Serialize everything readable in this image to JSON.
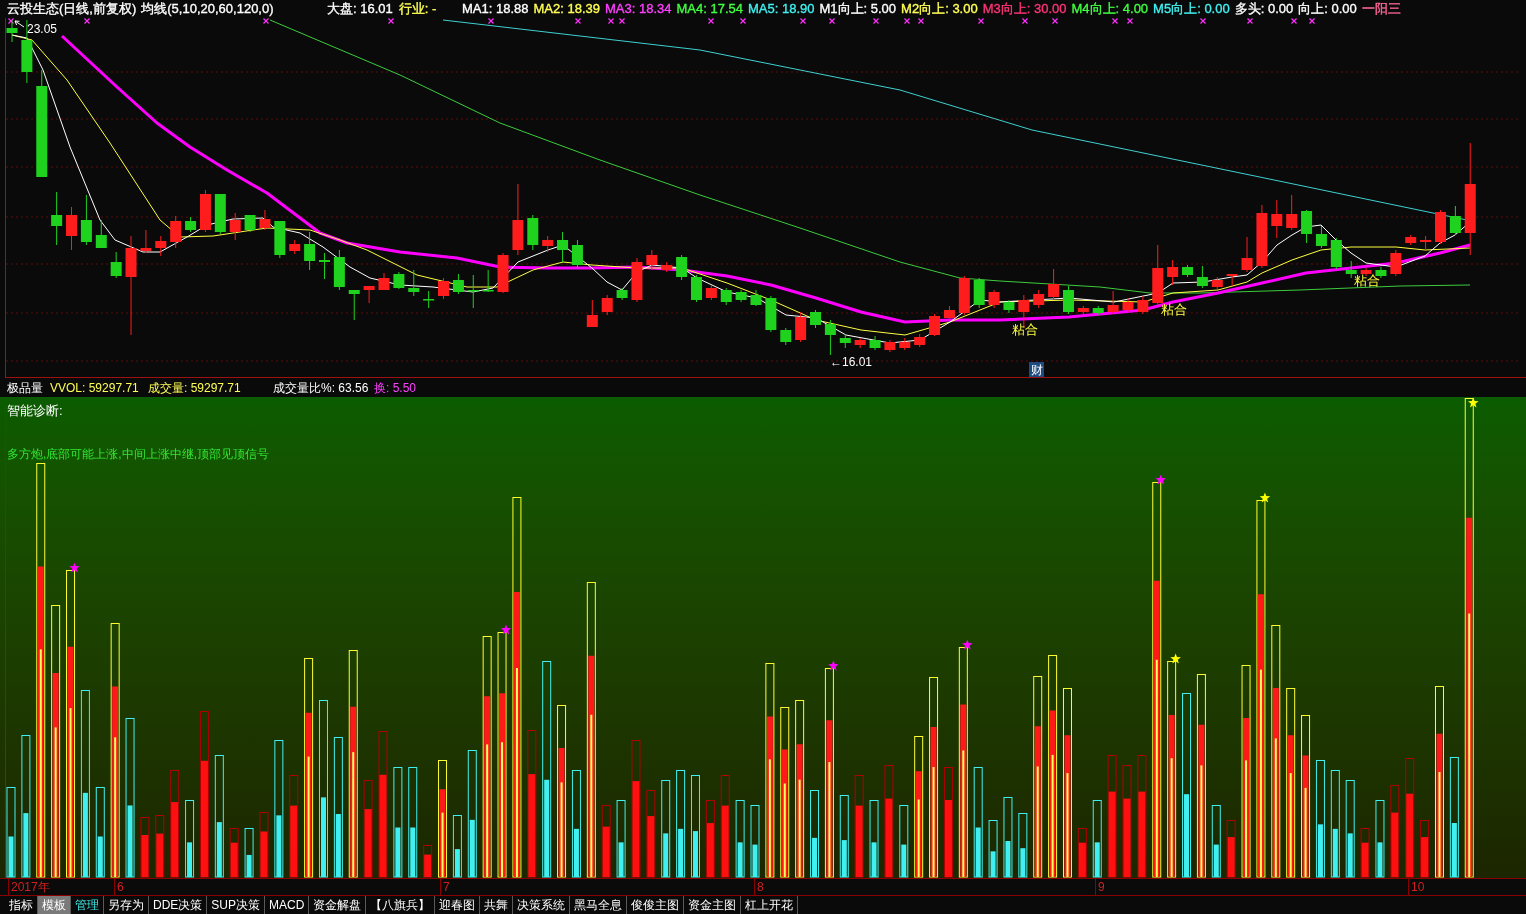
{
  "chart_header": {
    "title": "云投生态(日线,前复权)",
    "ma_setting": "均线(5,10,20,60,120,0)",
    "market": [
      {
        "text": "大盘: 16.01",
        "color": "#ffffff"
      },
      {
        "text": "行业: -",
        "color": "#ffff54"
      }
    ],
    "indicators": [
      {
        "text": "MA1: 18.88",
        "color": "#ffffff"
      },
      {
        "text": "MA2: 18.39",
        "color": "#ffff54"
      },
      {
        "text": "MA3: 18.34",
        "color": "#ff40ff"
      },
      {
        "text": "MA4: 17.54",
        "color": "#40ff40"
      },
      {
        "text": "MA5: 18.90",
        "color": "#40f0f0"
      },
      {
        "text": "M1向上: 5.00",
        "color": "#ffffff"
      },
      {
        "text": "M2向上: 3.00",
        "color": "#ffff54"
      },
      {
        "text": "M3向上: 30.00",
        "color": "#ff3377"
      },
      {
        "text": "M4向上: 4.00",
        "color": "#40ff40"
      },
      {
        "text": "M5向上: 0.00",
        "color": "#40f0f0"
      },
      {
        "text": "多头: 0.00",
        "color": "#ffffff"
      },
      {
        "text": "向上: 0.00",
        "color": "#ffffff"
      },
      {
        "text": "一阳三",
        "color": "#ff6699"
      }
    ]
  },
  "price_chart": {
    "high_label": "23.05",
    "low_label": "←16.01",
    "signal_labels": [
      "粘合",
      "粘合",
      "粘合"
    ],
    "finance_badge": "财"
  },
  "volume_header": {
    "name": "极品量",
    "readings": [
      {
        "text": "VVOL: 59297.71",
        "color": "#ffff54"
      },
      {
        "text": "成交量: 59297.71",
        "color": "#ffff54"
      },
      {
        "text": "成交量比%: 63.56",
        "color": "#ffffff"
      },
      {
        "text": "换: 5.50",
        "color": "#ff40ff"
      }
    ]
  },
  "diagnosis": {
    "title": "智能诊断:",
    "message": "多方炮,底部可能上涨,中间上涨中继,顶部见顶信号"
  },
  "time_axis": {
    "labels": [
      "2017年",
      "6",
      "7",
      "8",
      "9",
      "10"
    ]
  },
  "tabs": [
    {
      "label": "指标",
      "selected": false,
      "highlighted": false
    },
    {
      "label": "模板",
      "selected": true,
      "highlighted": false
    },
    {
      "label": "管理",
      "selected": false,
      "highlighted": true
    },
    {
      "label": "另存为",
      "selected": false,
      "highlighted": false
    },
    {
      "label": "DDE决策",
      "selected": false,
      "highlighted": false
    },
    {
      "label": "SUP决策",
      "selected": false,
      "highlighted": false
    },
    {
      "label": "MACD",
      "selected": false,
      "highlighted": false
    },
    {
      "label": "资金解盘",
      "selected": false,
      "highlighted": false
    },
    {
      "label": "【八旗兵】",
      "selected": false,
      "highlighted": false
    },
    {
      "label": "迎春图",
      "selected": false,
      "highlighted": false
    },
    {
      "label": "共舞",
      "selected": false,
      "highlighted": false
    },
    {
      "label": "决策系统",
      "selected": false,
      "highlighted": false
    },
    {
      "label": "黑马全息",
      "selected": false,
      "highlighted": false
    },
    {
      "label": "俊俊主图",
      "selected": false,
      "highlighted": false
    },
    {
      "label": "资金主图",
      "selected": false,
      "highlighted": false
    },
    {
      "label": "杠上开花",
      "selected": false,
      "highlighted": false
    }
  ]
}
